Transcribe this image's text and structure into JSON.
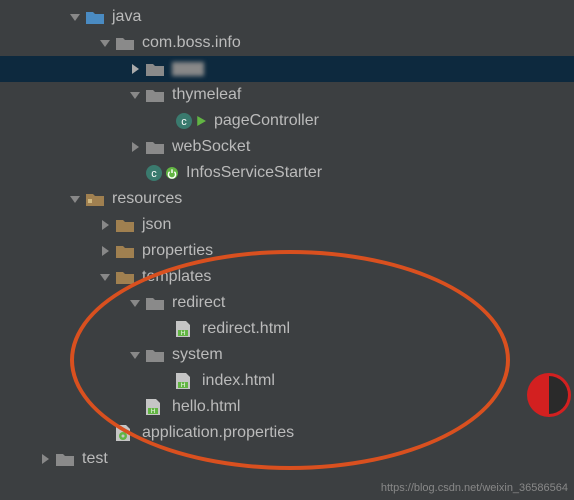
{
  "tree": {
    "java": "java",
    "comBoss": "com.boss.info",
    "blurred": " ",
    "thymeleaf": "thymeleaf",
    "pageController": "pageController",
    "webSocket": "webSocket",
    "infosServiceStarter": "InfosServiceStarter",
    "resources": "resources",
    "json": "json",
    "properties": "properties",
    "templates": "templates",
    "redirect": "redirect",
    "redirectHtml": "redirect.html",
    "system": "system",
    "indexHtml": "index.html",
    "helloHtml": "hello.html",
    "appProps": "application.properties",
    "test": "test"
  },
  "watermark": "https://blog.csdn.net/weixin_36586564"
}
